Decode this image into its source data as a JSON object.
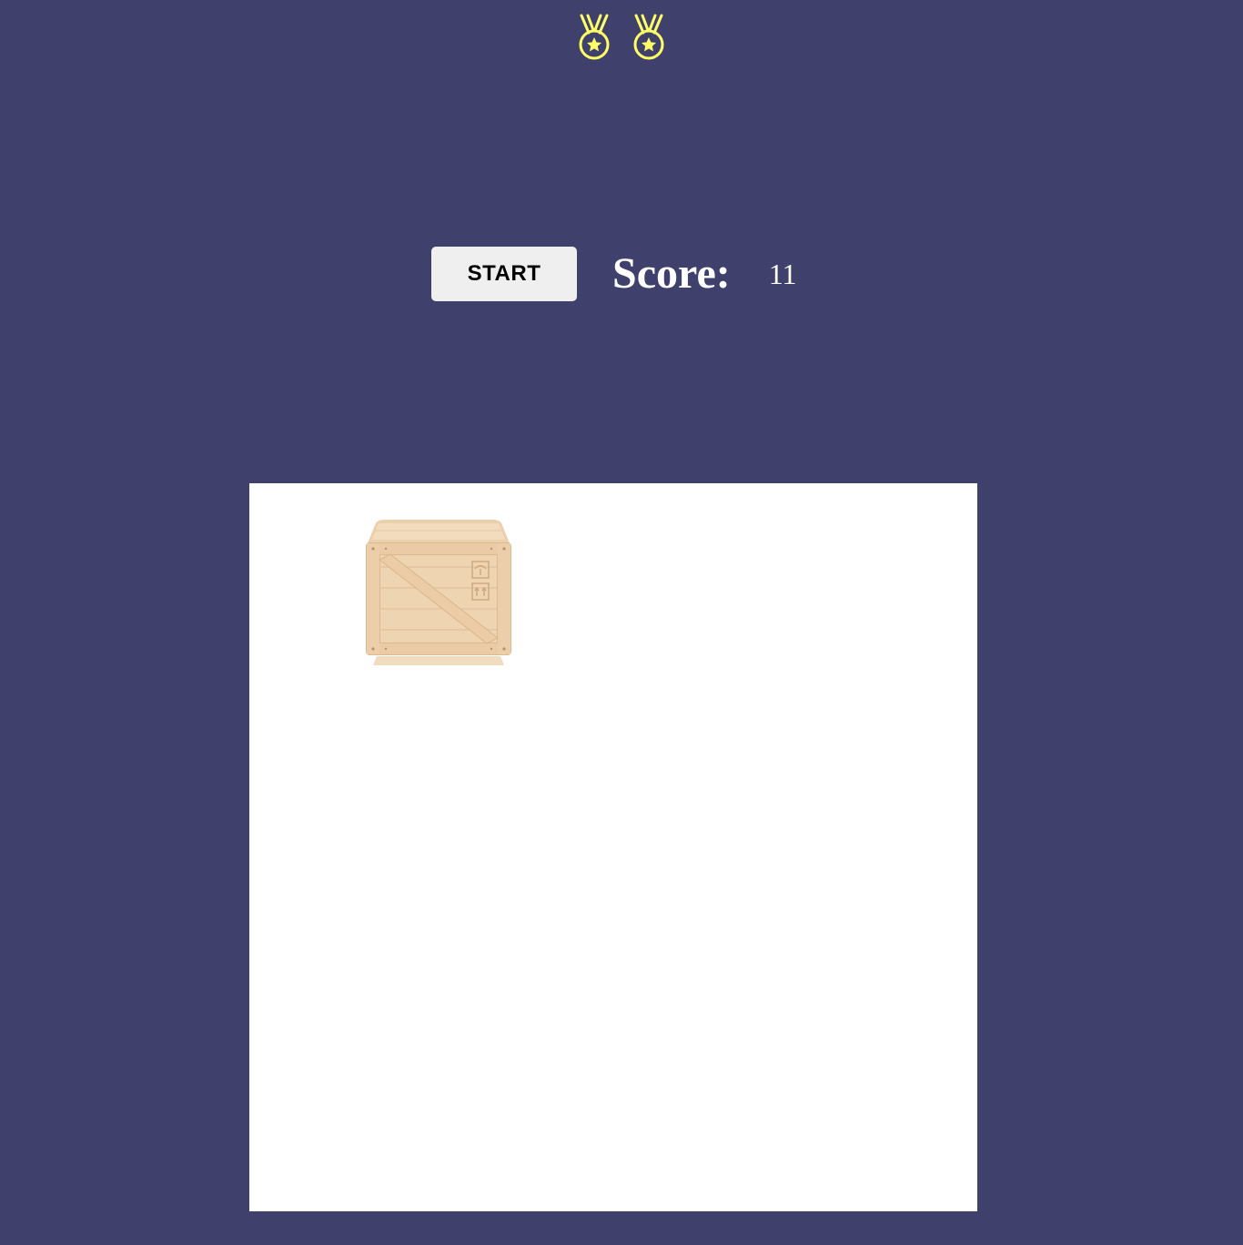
{
  "medals": {
    "count": 2,
    "color": "#ffff66",
    "icon": "medal-icon"
  },
  "controls": {
    "start_label": "START",
    "score_label": "Score:",
    "score_value": "11"
  },
  "board": {
    "background": "#ffffff",
    "target_icon": "wooden-crate-icon"
  },
  "colors": {
    "page_background": "#3f406c",
    "button_background": "#efefef"
  }
}
